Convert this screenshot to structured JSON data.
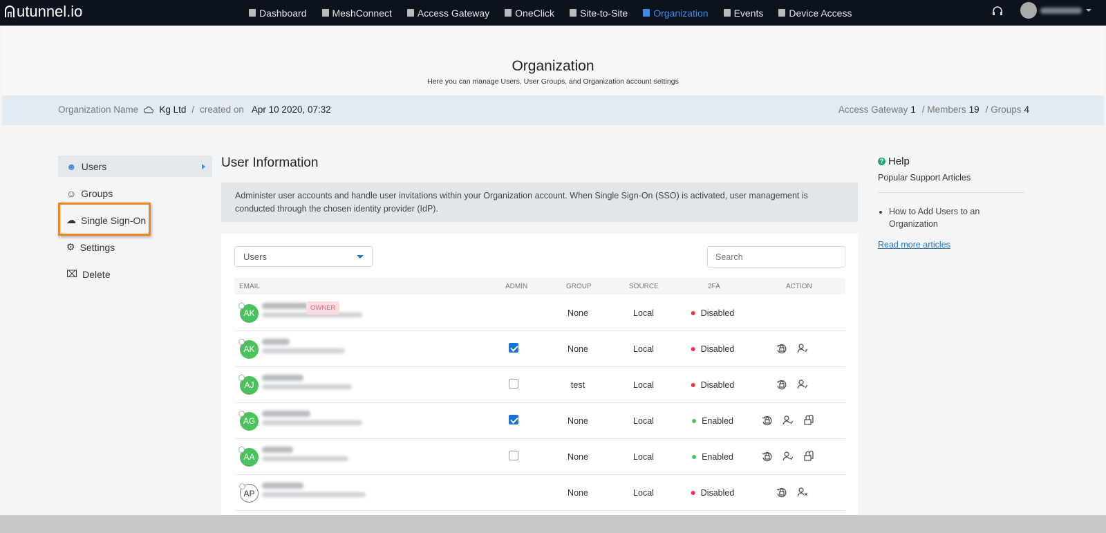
{
  "nav": {
    "logo": "utunnel.io",
    "items": [
      {
        "label": "Dashboard",
        "icon": "home-icon"
      },
      {
        "label": "MeshConnect",
        "icon": "mesh-icon"
      },
      {
        "label": "Access Gateway",
        "icon": "gateway-icon"
      },
      {
        "label": "OneClick",
        "icon": "grid-icon"
      },
      {
        "label": "Site-to-Site",
        "icon": "arrows-icon"
      },
      {
        "label": "Organization",
        "icon": "building-icon",
        "active": true
      },
      {
        "label": "Events",
        "icon": "list-icon"
      },
      {
        "label": "Device Access",
        "icon": "monitor-icon"
      }
    ]
  },
  "header": {
    "title": "Organization",
    "subtitle": "Here you can manage Users, User Groups, and Organization account settings"
  },
  "org": {
    "name_label": "Organization Name",
    "name": "Kg Ltd",
    "sep": "/",
    "created_label": "created on",
    "created": "Apr 10 2020, 07:32",
    "gateway_label": "Access Gateway",
    "gateway": "1",
    "members_label": "/ Members",
    "members": "19",
    "groups_label": "/ Groups",
    "groups": "4"
  },
  "sidebar": {
    "items": [
      {
        "label": "Users",
        "icon": "user-icon"
      },
      {
        "label": "Groups",
        "icon": "users-icon"
      },
      {
        "label": "Single Sign-On",
        "icon": "cloud-upload-icon"
      },
      {
        "label": "Settings",
        "icon": "gear-icon"
      },
      {
        "label": "Delete",
        "icon": "delete-box-icon"
      }
    ]
  },
  "main": {
    "title": "User Information",
    "info": "Administer user accounts and handle user invitations within your Organization account. When Single Sign-On (SSO) is activated, user management is conducted through the chosen identity provider (IdP).",
    "filter": "Users",
    "search_placeholder": "Search",
    "columns": [
      "EMAIL",
      "ADMIN",
      "GROUP",
      "SOURCE",
      "2FA",
      "ACTION"
    ],
    "owner_badge": "OWNER",
    "rows": [
      {
        "initials": "AK",
        "admin": null,
        "group": "None",
        "source": "Local",
        "twofa": "Disabled",
        "owner": true,
        "actions": []
      },
      {
        "initials": "AK",
        "admin": true,
        "group": "None",
        "source": "Local",
        "twofa": "Disabled",
        "actions": [
          "reset-2fa",
          "activate-user"
        ]
      },
      {
        "initials": "AJ",
        "admin": false,
        "group": "test",
        "source": "Local",
        "twofa": "Disabled",
        "actions": [
          "reset-2fa",
          "activate-user"
        ]
      },
      {
        "initials": "AG",
        "admin": true,
        "group": "None",
        "source": "Local",
        "twofa": "Enabled",
        "actions": [
          "reset-2fa",
          "activate-user",
          "lock"
        ]
      },
      {
        "initials": "AA",
        "admin": false,
        "group": "None",
        "source": "Local",
        "twofa": "Enabled",
        "actions": [
          "reset-2fa",
          "activate-user",
          "lock"
        ]
      },
      {
        "initials": "AP",
        "admin": null,
        "group": "None",
        "source": "Local",
        "twofa": "Disabled",
        "pending": true,
        "actions": [
          "reset-2fa",
          "deactivate-user"
        ]
      }
    ]
  },
  "help": {
    "title": "Help",
    "subtitle": "Popular Support Articles",
    "articles": [
      "How to Add Users to an Organization"
    ],
    "more": "Read more articles"
  },
  "colors": {
    "nav_bg": "#0c131d",
    "active": "#3d8be8",
    "enabled": "#4cc05d",
    "disabled": "#e0384b",
    "highlight": "#f0861a"
  }
}
